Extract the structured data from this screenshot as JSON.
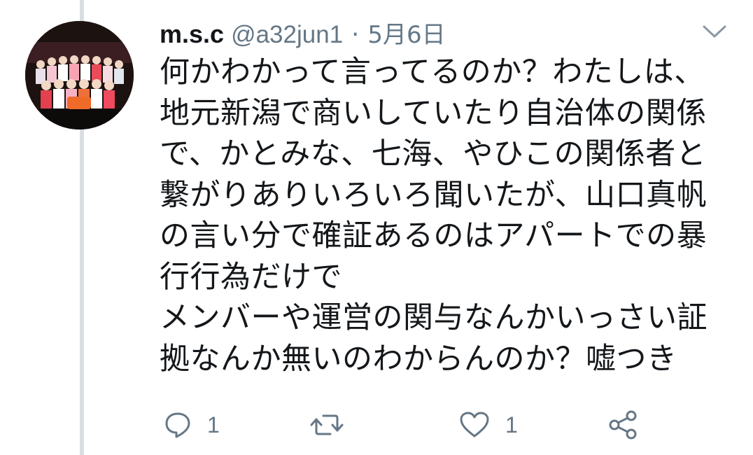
{
  "tweet": {
    "display_name": "m.s.c",
    "handle": "@a32jun1",
    "separator": "·",
    "date": "5月6日",
    "body_lines": [
      "何かわかって言ってるのか？わたしは、",
      "地元新潟で商いしていたり自治体の関係",
      "で、かとみな、七海、やひこの関係者と",
      "繋がりありいろいろ聞いたが、山口真帆",
      "の言い分で確証あるのはアパートでの暴",
      "行行為だけで",
      "メンバーや運営の関与なんかいっさい証",
      "拠なんか無いのわからんのか？嘘つき"
    ],
    "actions": {
      "reply_count": "1",
      "retweet_count": "",
      "like_count": "1"
    }
  },
  "icons": {
    "menu": "chevron-down-icon",
    "reply": "reply-icon",
    "retweet": "retweet-icon",
    "like": "heart-icon",
    "share": "share-icon"
  },
  "colors": {
    "secondary_text": "#657786",
    "primary_text": "#14171a",
    "thread_line": "#d9dee2"
  }
}
